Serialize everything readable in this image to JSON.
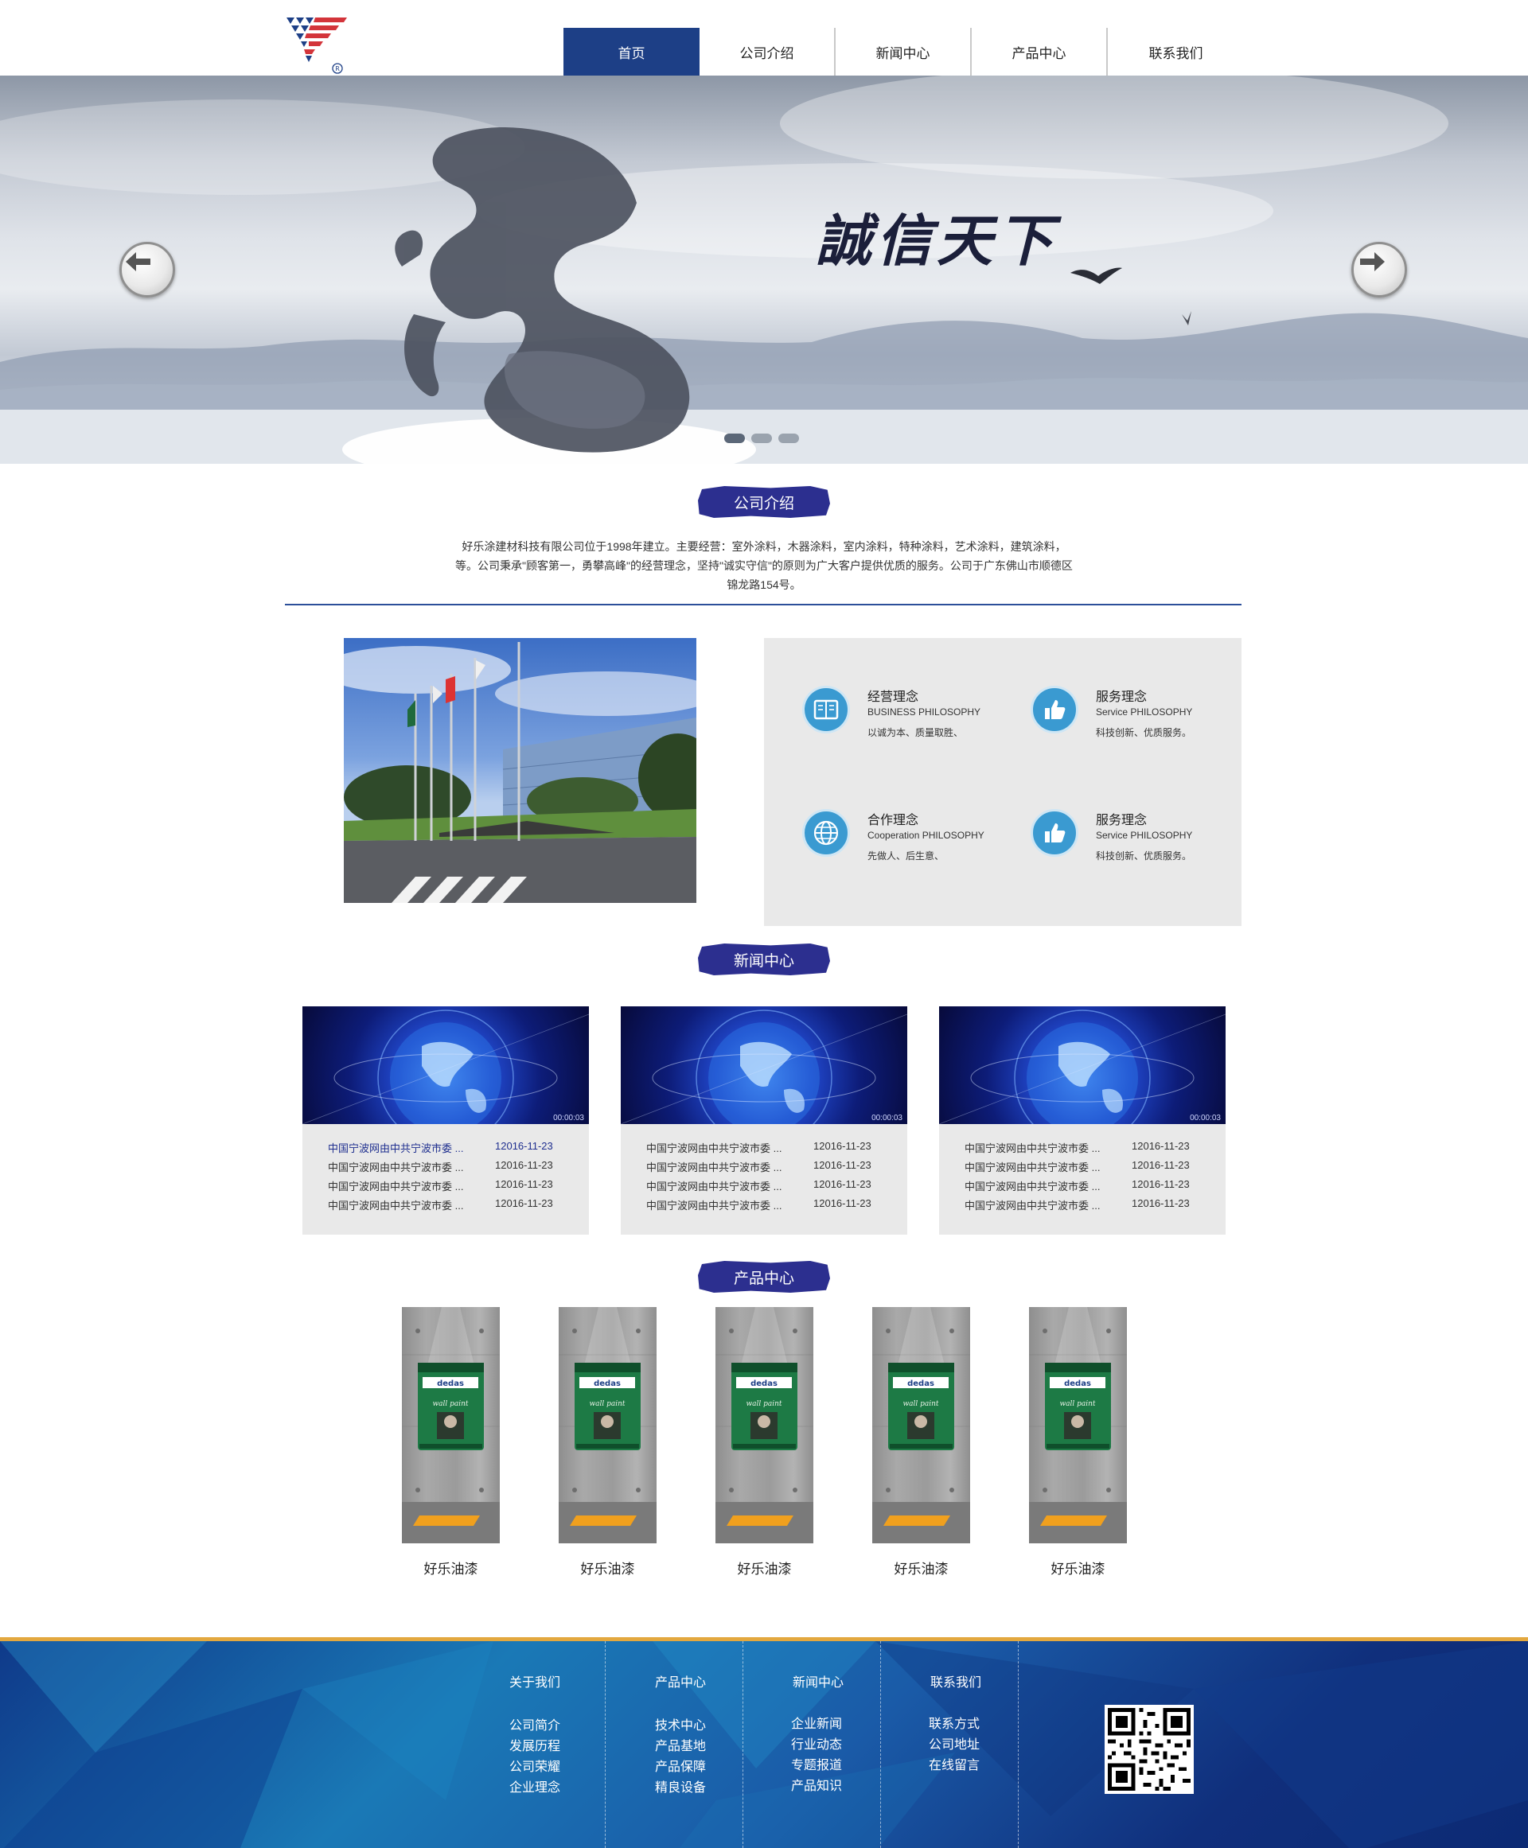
{
  "header": {
    "logo_mark": "®",
    "nav": [
      "首页",
      "公司介绍",
      "新闻中心",
      "产品中心",
      "联系我们"
    ],
    "active_index": 0
  },
  "banner": {
    "slogan": "誠信天下",
    "slides": 3,
    "active_slide": 0
  },
  "about": {
    "title": "公司介绍",
    "text": "好乐涂建材科技有限公司位于1998年建立。主要经营：室外涂料，木器涂料，室内涂料，特种涂料，艺术涂料，建筑涂料，等。公司秉承\"顾客第一，勇攀高峰\"的经营理念，坚持\"诚实守信\"的原则为广大客户提供优质的服务。公司于广东佛山市顺德区锦龙路154号。",
    "philosophies": [
      {
        "icon": "book-icon",
        "title": "经营理念",
        "sub": "BUSINESS PHILOSOPHY",
        "desc": "以诚为本、质量取胜、"
      },
      {
        "icon": "thumbs-up-icon",
        "title": "服务理念",
        "sub": "Service PHILOSOPHY",
        "desc": "科技创新、优质服务。"
      },
      {
        "icon": "globe-icon",
        "title": "合作理念",
        "sub": "Cooperation PHILOSOPHY",
        "desc": "先做人、后生意、"
      },
      {
        "icon": "thumbs-up-icon",
        "title": "服务理念",
        "sub": "Service PHILOSOPHY",
        "desc": "科技创新、优质服务。"
      }
    ]
  },
  "news": {
    "title": "新闻中心",
    "video_time": "00:00:03",
    "cards": [
      {
        "rows": [
          {
            "title": "中国宁波网由中共宁波市委 ...",
            "date": "12016-11-23",
            "highlight": true
          },
          {
            "title": "中国宁波网由中共宁波市委 ...",
            "date": "12016-11-23"
          },
          {
            "title": "中国宁波网由中共宁波市委 ...",
            "date": "12016-11-23"
          },
          {
            "title": "中国宁波网由中共宁波市委 ...",
            "date": "12016-11-23"
          }
        ]
      },
      {
        "rows": [
          {
            "title": "中国宁波网由中共宁波市委 ...",
            "date": "12016-11-23"
          },
          {
            "title": "中国宁波网由中共宁波市委 ...",
            "date": "12016-11-23"
          },
          {
            "title": "中国宁波网由中共宁波市委 ...",
            "date": "12016-11-23"
          },
          {
            "title": "中国宁波网由中共宁波市委 ...",
            "date": "12016-11-23"
          }
        ]
      },
      {
        "rows": [
          {
            "title": "中国宁波网由中共宁波市委 ...",
            "date": "12016-11-23"
          },
          {
            "title": "中国宁波网由中共宁波市委 ...",
            "date": "12016-11-23"
          },
          {
            "title": "中国宁波网由中共宁波市委 ...",
            "date": "12016-11-23"
          },
          {
            "title": "中国宁波网由中共宁波市委 ...",
            "date": "12016-11-23"
          }
        ]
      }
    ]
  },
  "products": {
    "title": "产品中心",
    "can_brand": "dedas",
    "can_text": "wall paint",
    "items": [
      "好乐油漆",
      "好乐油漆",
      "好乐油漆",
      "好乐油漆",
      "好乐油漆"
    ]
  },
  "footer": {
    "columns": [
      {
        "head": "关于我们",
        "links": [
          "公司简介",
          "发展历程",
          "公司荣耀",
          "企业理念"
        ]
      },
      {
        "head": "产品中心",
        "links": [
          "技术中心",
          "产品基地",
          "产品保障",
          "精良设备"
        ]
      },
      {
        "head": "新闻中心",
        "links": [
          "企业新闻",
          "行业动态",
          "专题报道",
          "产品知识"
        ]
      },
      {
        "head": "联系我们",
        "links": [
          "联系方式",
          "公司地址",
          "在线留言"
        ]
      }
    ]
  },
  "colors": {
    "nav_active": "#1d3f86",
    "badge": "#2c2f8f",
    "icon_blue": "#3a9ad1",
    "footer_border": "#e3a83f"
  }
}
